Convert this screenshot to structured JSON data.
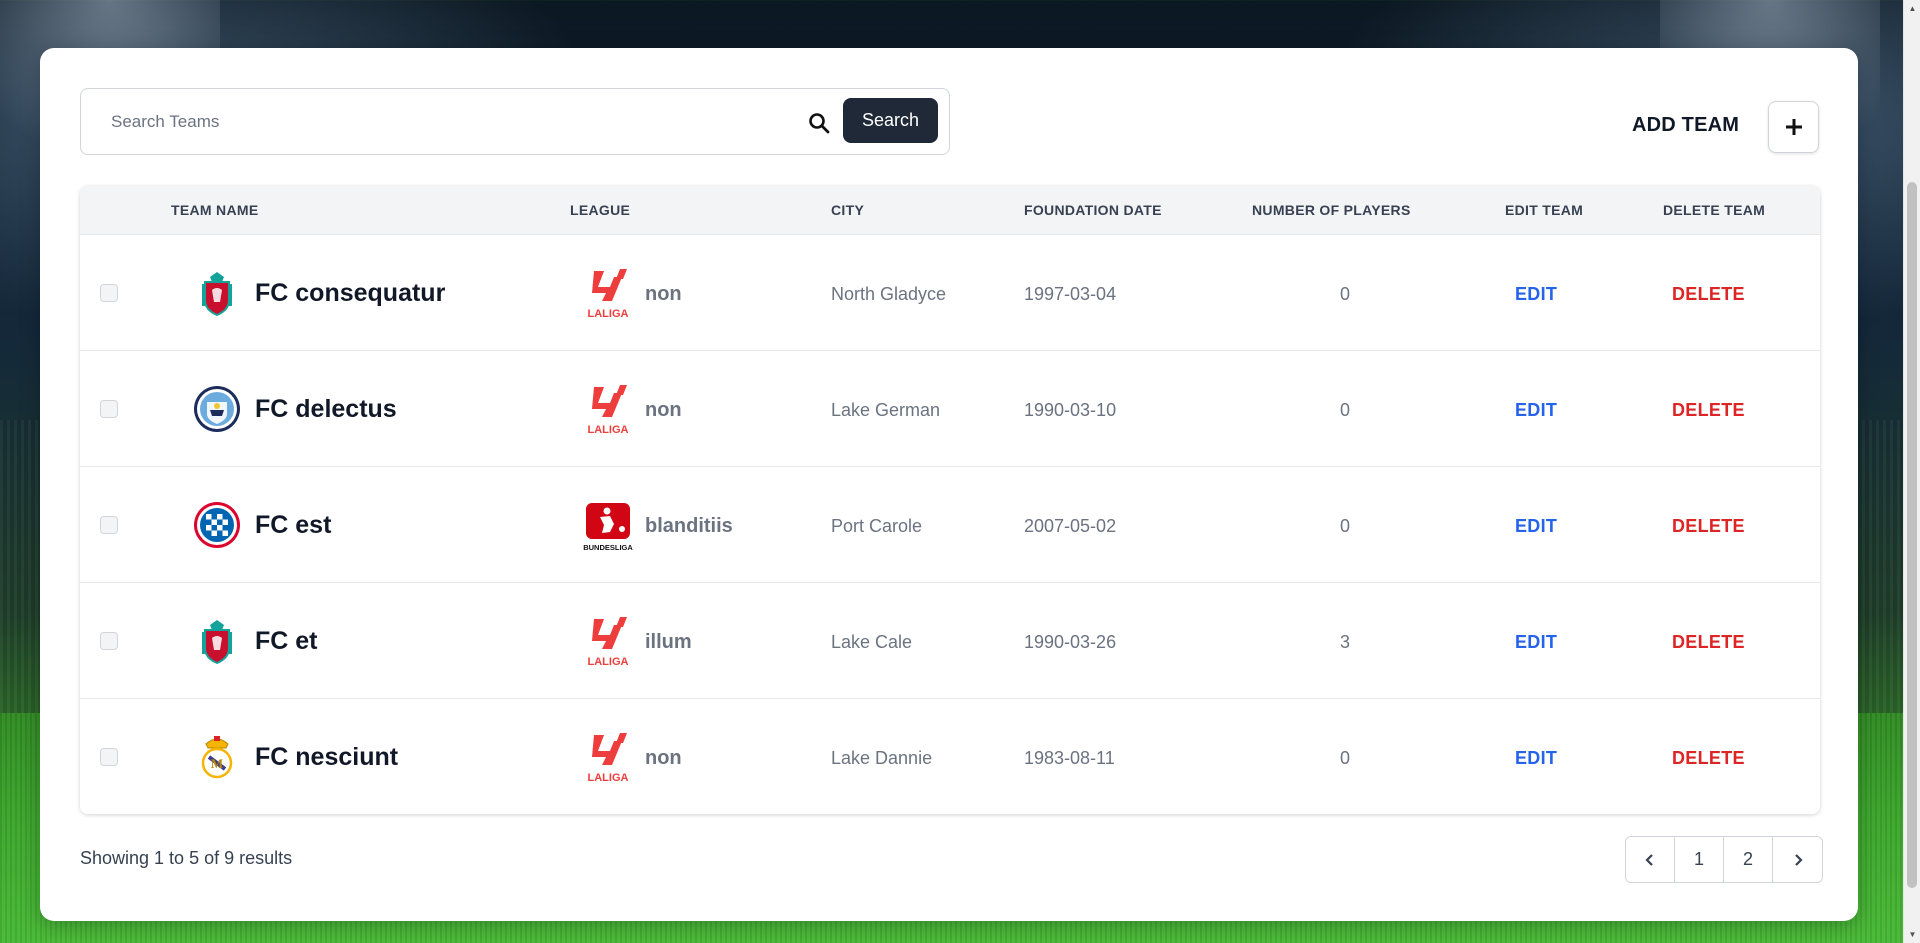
{
  "search": {
    "placeholder": "Search Teams",
    "value": "",
    "button_label": "Search"
  },
  "add_team": {
    "label": "ADD TEAM",
    "button_icon": "plus-icon"
  },
  "table": {
    "headers": {
      "team_name": "TEAM NAME",
      "league": "LEAGUE",
      "city": "CITY",
      "foundation_date": "FOUNDATION DATE",
      "number_of_players": "NUMBER OF PLAYERS",
      "edit_team": "EDIT TEAM",
      "delete_team": "DELETE TEAM"
    },
    "rows": [
      {
        "team": "FC consequatur",
        "team_logo": "liverpool-crest-icon",
        "league": "non",
        "league_logo": "laliga-logo-icon",
        "city": "North Gladyce",
        "date": "1997-03-04",
        "players": "0",
        "edit": "EDIT",
        "delete": "DELETE"
      },
      {
        "team": "FC delectus",
        "team_logo": "manchester-city-crest-icon",
        "league": "non",
        "league_logo": "laliga-logo-icon",
        "city": "Lake German",
        "date": "1990-03-10",
        "players": "0",
        "edit": "EDIT",
        "delete": "DELETE"
      },
      {
        "team": "FC est",
        "team_logo": "bayern-crest-icon",
        "league": "blanditiis",
        "league_logo": "bundesliga-logo-icon",
        "city": "Port Carole",
        "date": "2007-05-02",
        "players": "0",
        "edit": "EDIT",
        "delete": "DELETE"
      },
      {
        "team": "FC et",
        "team_logo": "liverpool-crest-icon",
        "league": "illum",
        "league_logo": "laliga-logo-icon",
        "city": "Lake Cale",
        "date": "1990-03-26",
        "players": "3",
        "edit": "EDIT",
        "delete": "DELETE"
      },
      {
        "team": "FC nesciunt",
        "team_logo": "real-madrid-crest-icon",
        "league": "non",
        "league_logo": "laliga-logo-icon",
        "city": "Lake Dannie",
        "date": "1983-08-11",
        "players": "0",
        "edit": "EDIT",
        "delete": "DELETE"
      }
    ]
  },
  "logos": {
    "laliga_text": "LALIGA",
    "bundesliga_text": "BUNDESLIGA"
  },
  "footer": {
    "results_text": "Showing 1 to 5 of 9 results",
    "pages": [
      "1",
      "2"
    ]
  },
  "colors": {
    "edit": "#2563eb",
    "delete": "#dc2626",
    "search_button": "#1f2937",
    "laliga_red": "#ee3d3d",
    "bundesliga_red": "#d20515"
  }
}
